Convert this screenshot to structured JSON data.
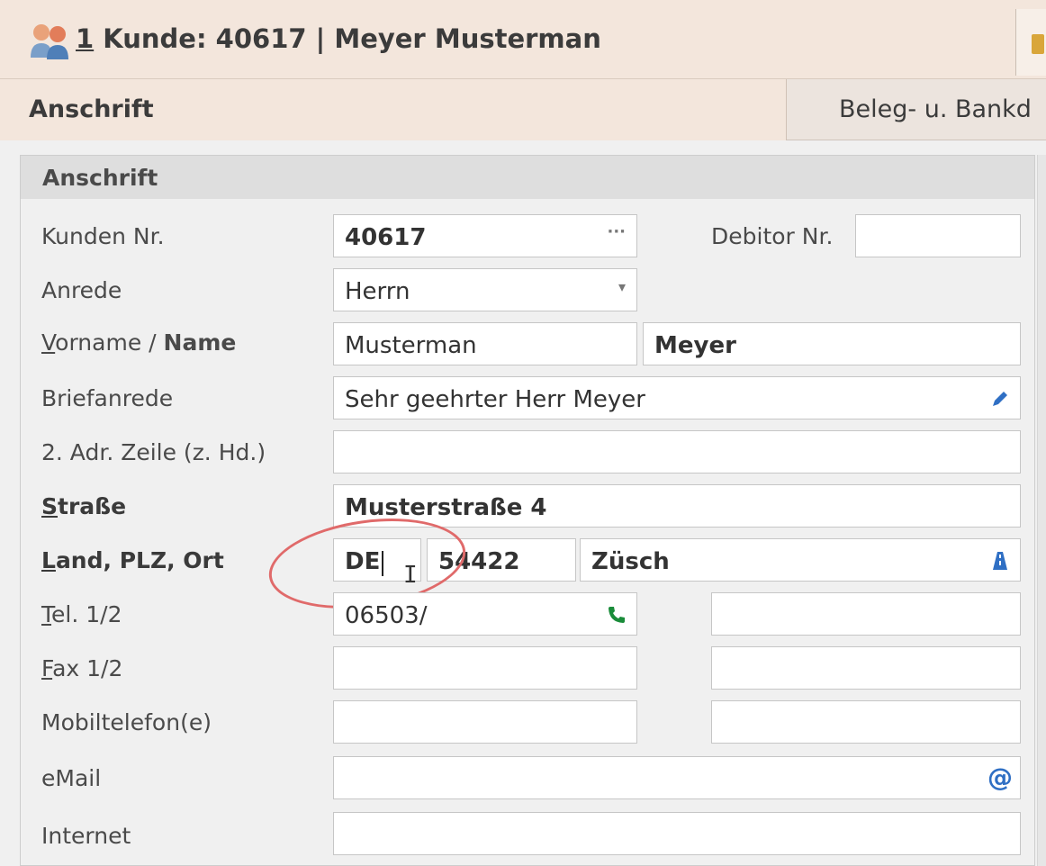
{
  "window": {
    "title_num": "1",
    "title_rest": " Kunde: 40617 | Meyer Musterman"
  },
  "tabs": [
    {
      "label": "Anschrift",
      "active": true
    },
    {
      "label": "Beleg- u. Bankd",
      "active": false
    }
  ],
  "group": {
    "title": "Anschrift"
  },
  "fields": {
    "kunden_nr": {
      "label": "Kunden Nr.",
      "value": "40617",
      "button": "···"
    },
    "debitor_nr": {
      "label": "Debitor Nr.",
      "value": ""
    },
    "anrede": {
      "label": "Anrede",
      "value": "Herrn",
      "dropdown": "▾"
    },
    "vorname_name": {
      "label_a": "V",
      "label_b": "orname / ",
      "label_c": "Name",
      "vorname": "Musterman",
      "name": "Meyer"
    },
    "briefanrede": {
      "label": "Briefanrede",
      "value": "Sehr geehrter Herr Meyer"
    },
    "adr_zeile2": {
      "label": "2. Adr. Zeile (z. Hd.)",
      "value": ""
    },
    "strasse": {
      "label_a": "S",
      "label_b": "traße",
      "value": "Musterstraße 4"
    },
    "land_plz_ort": {
      "label_a": "L",
      "label_b": "and, PLZ, Ort",
      "land": "DE",
      "plz": "54422",
      "ort": "Züsch"
    },
    "tel": {
      "label_a": "T",
      "label_b": "el. 1/2",
      "tel1": "06503/",
      "tel2": ""
    },
    "fax": {
      "label_a": "F",
      "label_b": "ax 1/2",
      "fax1": "",
      "fax2": ""
    },
    "mobil": {
      "label": "Mobiltelefon(e)",
      "mobil1": "",
      "mobil2": ""
    },
    "email": {
      "label": "eMail",
      "value": "",
      "icon": "@"
    },
    "internet": {
      "label": "Internet",
      "value": ""
    }
  },
  "colors": {
    "header_bg": "#f3e6dc",
    "highlight_circle": "#e06a6a",
    "edit_icon": "#2f6fc4",
    "phone_icon": "#1a8c3a",
    "email_icon": "#2f6fc4"
  },
  "cursor_glyph": "I"
}
